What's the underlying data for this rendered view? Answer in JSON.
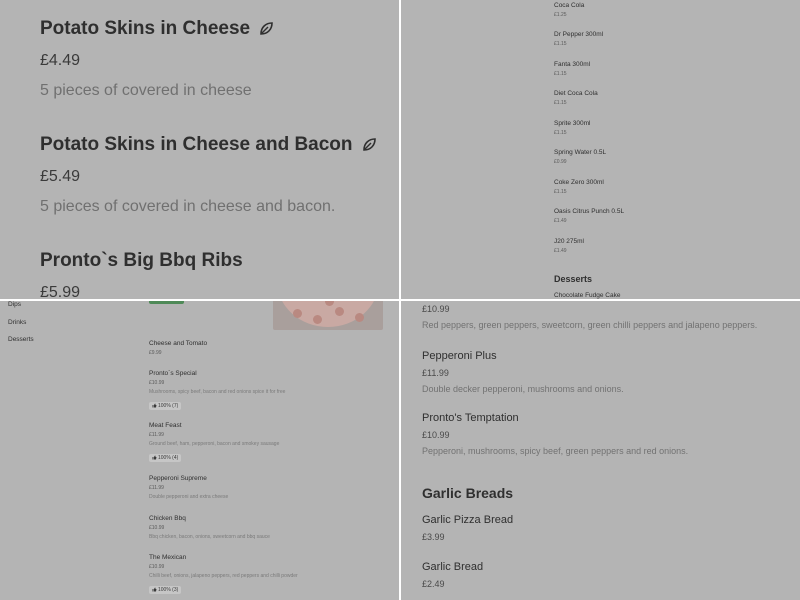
{
  "panel_top_left": {
    "items": [
      {
        "name": "Potato Skins in Cheese",
        "price": "£4.49",
        "description": "5 pieces of covered in cheese"
      },
      {
        "name": "Potato Skins in Cheese and Bacon",
        "price": "£5.49",
        "description": "5 pieces of covered in cheese and bacon."
      },
      {
        "name": "Pronto`s Big Bbq Ribs",
        "price": "£5.99"
      }
    ],
    "icon": "leaf-icon"
  },
  "panel_top_right": {
    "drinks": [
      {
        "name": "Coca Cola",
        "price": "£1.25"
      },
      {
        "name": "Dr Pepper 300ml",
        "price": "£1.15"
      },
      {
        "name": "Fanta 300ml",
        "price": "£1.15"
      },
      {
        "name": "Diet Coca Cola",
        "price": "£1.15"
      },
      {
        "name": "Sprite 300ml",
        "price": "£1.15"
      },
      {
        "name": "Spring Water 0.5L",
        "price": "£0.99"
      },
      {
        "name": "Coke Zero 300ml",
        "price": "£1.15"
      },
      {
        "name": "Oasis Citrus Punch 0.5L",
        "price": "£1.49"
      },
      {
        "name": "J20 275ml",
        "price": "£1.49"
      }
    ],
    "section_title": "Desserts",
    "first_dessert": "Chocolate Fudge Cake"
  },
  "panel_bottom_left": {
    "sidebar": [
      "Dips",
      "Drinks",
      "Desserts"
    ],
    "items": [
      {
        "name": "Cheese and Tomato",
        "price": "£9.99"
      },
      {
        "name": "Pronto`s Special",
        "price": "£10.99",
        "description": "Mushrooms, spicy beef, bacon and red onions spice it for free",
        "rating": "100% (7)"
      },
      {
        "name": "Meat Feast",
        "price": "£11.99",
        "description": "Ground beef, ham, pepperoni, bacon and smokey sausage",
        "rating": "100% (4)"
      },
      {
        "name": "Pepperoni Supreme",
        "price": "£11.99",
        "description": "Double pepperoni and extra cheese"
      },
      {
        "name": "Chicken Bbq",
        "price": "£10.99",
        "description": "Bbq chicken, bacon, onions, sweetcorn and bbq sauce"
      },
      {
        "name": "The Mexican",
        "price": "£10.99",
        "description": "Chilli beef, onions, jalapeno peppers, red peppers and chilli powder",
        "rating": "100% (3)"
      }
    ],
    "colors": {
      "badge": "#4f8a58"
    }
  },
  "panel_bottom_right": {
    "top_price": "£10.99",
    "top_description": "Red peppers, green peppers, sweetcorn, green chilli peppers and jalapeno peppers.",
    "items": [
      {
        "name": "Pepperoni Plus",
        "price": "£11.99",
        "description": "Double decker pepperoni, mushrooms and onions."
      },
      {
        "name": "Pronto's Temptation",
        "price": "£10.99",
        "description": "Pepperoni, mushrooms, spicy beef, green peppers and red onions."
      }
    ],
    "section_title": "Garlic Breads",
    "garlic_items": [
      {
        "name": "Garlic Pizza Bread",
        "price": "£3.99"
      },
      {
        "name": "Garlic Bread",
        "price": "£2.49"
      }
    ]
  }
}
